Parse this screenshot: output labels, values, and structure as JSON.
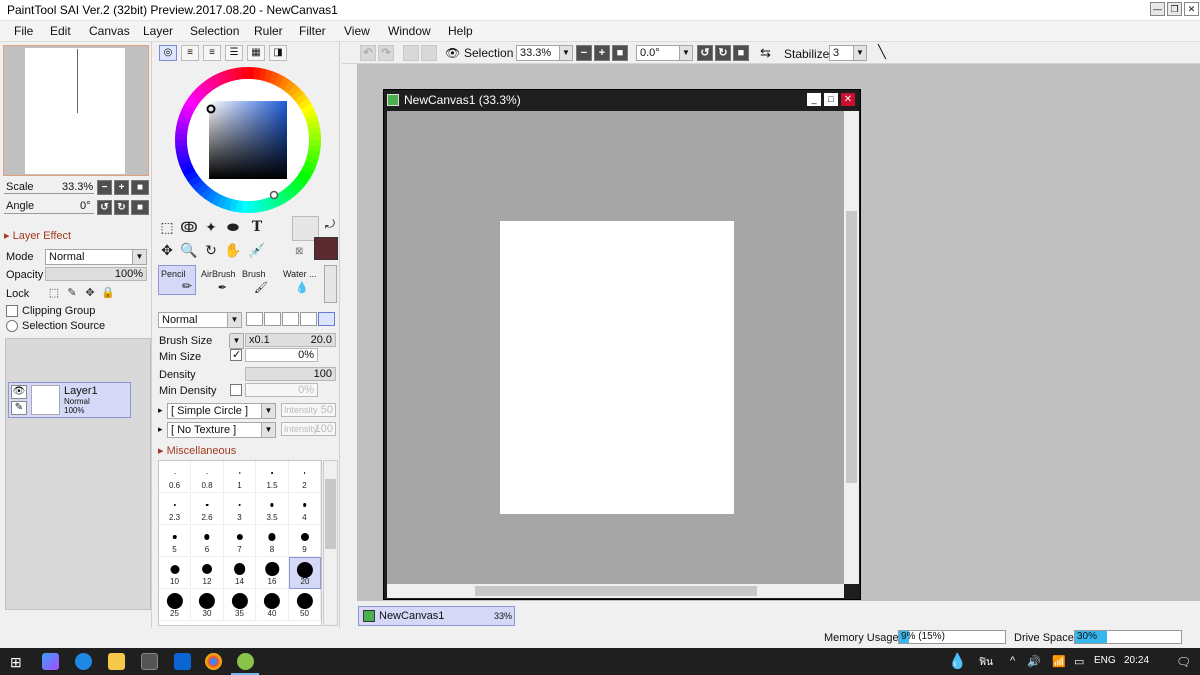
{
  "window": {
    "title": "PaintTool SAI Ver.2 (32bit) Preview.2017.08.20 - NewCanvas1"
  },
  "menu": [
    "File",
    "Edit",
    "Canvas",
    "Layer",
    "Selection",
    "Ruler",
    "Filter",
    "View",
    "Window",
    "Help"
  ],
  "navigator": {
    "scale_label": "Scale",
    "scale_value": "33.3%",
    "angle_label": "Angle",
    "angle_value": "0°"
  },
  "layer_panel": {
    "section_title": "Layer Effect",
    "mode_label": "Mode",
    "mode_value": "Normal",
    "opacity_label": "Opacity",
    "opacity_value": "100%",
    "lock_label": "Lock",
    "clipping_label": "Clipping Group",
    "selection_source_label": "Selection Source",
    "layers": [
      {
        "name": "Layer1",
        "mode": "Normal",
        "opacity": "100%"
      }
    ]
  },
  "tools": {
    "brushes": [
      {
        "name": "Pencil",
        "selected": true
      },
      {
        "name": "AirBrush",
        "selected": false
      },
      {
        "name": "Brush",
        "selected": false
      },
      {
        "name": "Water ...",
        "selected": false
      }
    ],
    "blend_mode": "Normal",
    "brush_size_label": "Brush Size",
    "brush_size_mult": "x0.1",
    "brush_size_value": "20.0",
    "min_size_label": "Min Size",
    "min_size_value": "0%",
    "density_label": "Density",
    "density_value": "100",
    "min_density_label": "Min Density",
    "min_density_value": "0%",
    "shape_value": "[ Simple Circle ]",
    "shape_intensity_label": "Intensity",
    "shape_intensity_value": "50",
    "texture_value": "[ No Texture ]",
    "texture_intensity_label": "Intensity",
    "texture_intensity_value": "100",
    "misc_label": "Miscellaneous",
    "sizes": [
      {
        "label": "0.6",
        "d": 1
      },
      {
        "label": "0.8",
        "d": 1
      },
      {
        "label": "1",
        "d": 1.5
      },
      {
        "label": "1.5",
        "d": 2
      },
      {
        "label": "2",
        "d": 2
      },
      {
        "label": "2.3",
        "d": 2.5
      },
      {
        "label": "2.6",
        "d": 3
      },
      {
        "label": "3",
        "d": 3
      },
      {
        "label": "3.5",
        "d": 3.5
      },
      {
        "label": "4",
        "d": 4
      },
      {
        "label": "5",
        "d": 5
      },
      {
        "label": "6",
        "d": 6
      },
      {
        "label": "7",
        "d": 7
      },
      {
        "label": "8",
        "d": 8
      },
      {
        "label": "9",
        "d": 9
      },
      {
        "label": "10",
        "d": 10
      },
      {
        "label": "12",
        "d": 11
      },
      {
        "label": "14",
        "d": 13
      },
      {
        "label": "16",
        "d": 15
      },
      {
        "label": "20",
        "d": 18
      },
      {
        "label": "25",
        "d": 18
      },
      {
        "label": "30",
        "d": 18
      },
      {
        "label": "35",
        "d": 18
      },
      {
        "label": "40",
        "d": 18
      },
      {
        "label": "50",
        "d": 18
      }
    ],
    "selected_size": "20"
  },
  "toolbar": {
    "selection_label": "Selection",
    "zoom_value": "33.3%",
    "angle_value": "0.0°",
    "stabilizer_label": "Stabilizer",
    "stabilizer_value": "3"
  },
  "canvas": {
    "window_title": "NewCanvas1 (33.3%)",
    "tab_name": "NewCanvas1",
    "tab_zoom": "33%"
  },
  "status": {
    "memory_label": "Memory Usage",
    "memory_value": "9% (15%)",
    "memory_fill": 0.09,
    "drive_label": "Drive Space",
    "drive_value": "30%",
    "drive_fill": 0.3
  },
  "taskbar": {
    "lang": "ENG",
    "time": "20:24"
  },
  "colors": {
    "accent_section": "#a33b21",
    "selection_bg": "#d5d9f7",
    "foreground_color": "#5b2a2f",
    "background_color": "#e6e6e6"
  }
}
